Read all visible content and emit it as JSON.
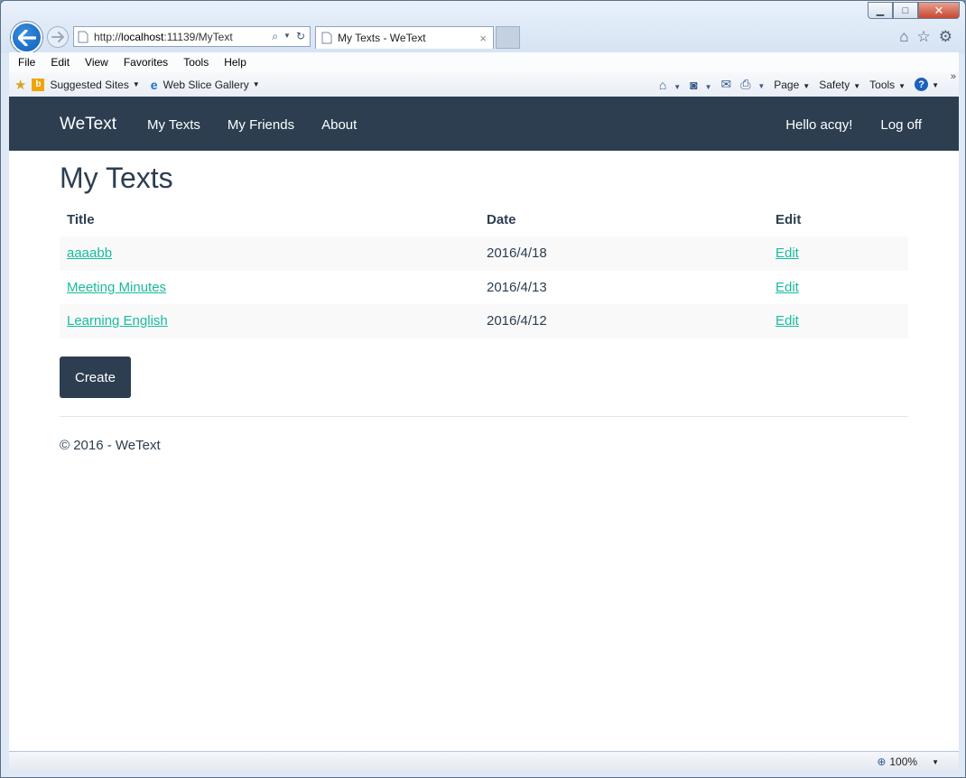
{
  "browser": {
    "address": {
      "prefix": "http://",
      "host": "localhost",
      "rest": ":11139/MyText"
    },
    "tab": {
      "title": "My Texts - WeText",
      "close": "×"
    },
    "window_controls": {
      "minimize": "▁",
      "maximize": "□",
      "close": "✕"
    },
    "menu": [
      "File",
      "Edit",
      "View",
      "Favorites",
      "Tools",
      "Help"
    ],
    "favorites": [
      {
        "label": "Suggested Sites",
        "icon": "bing-icon"
      },
      {
        "label": "Web Slice Gallery",
        "icon": "ie-icon"
      }
    ],
    "command_bar": {
      "page": "Page",
      "safety": "Safety",
      "tools": "Tools"
    },
    "status": {
      "zoom": "100%"
    }
  },
  "site": {
    "brand": "WeText",
    "nav": [
      "My Texts",
      "My Friends",
      "About"
    ],
    "user": {
      "greeting": "Hello acqy!",
      "logoff": "Log off"
    }
  },
  "main": {
    "title": "My Texts",
    "table": {
      "headers": {
        "title": "Title",
        "date": "Date",
        "edit": "Edit"
      },
      "rows": [
        {
          "title": "aaaabb",
          "date": "2016/4/18",
          "edit": "Edit"
        },
        {
          "title": "Meeting Minutes",
          "date": "2016/4/13",
          "edit": "Edit"
        },
        {
          "title": "Learning English",
          "date": "2016/4/12",
          "edit": "Edit"
        }
      ]
    },
    "create_label": "Create",
    "footer": "© 2016 - WeText"
  },
  "colors": {
    "navbar": "#2c3e50",
    "link": "#18bc9c",
    "stripe": "#f9f9f9"
  }
}
